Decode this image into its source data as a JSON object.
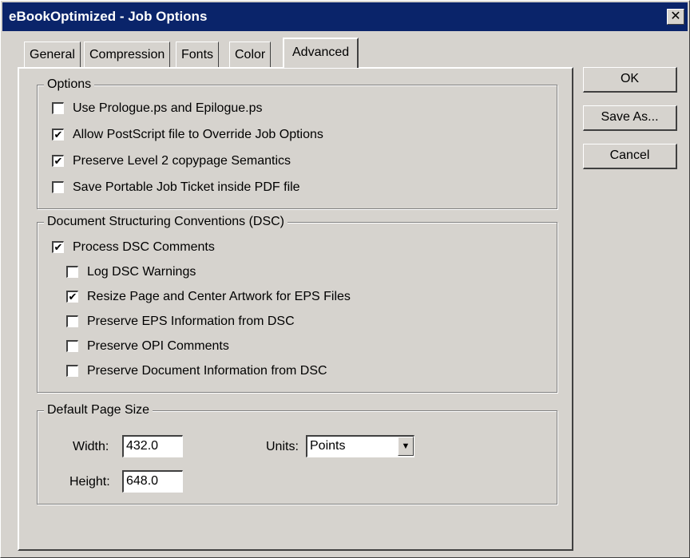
{
  "window": {
    "title": "eBookOptimized - Job Options",
    "close_glyph": "✕"
  },
  "tabs": [
    {
      "label": "General",
      "active": false
    },
    {
      "label": "Compression",
      "active": false
    },
    {
      "label": "Fonts",
      "active": false
    },
    {
      "label": "Color",
      "active": false
    },
    {
      "label": "Advanced",
      "active": true
    }
  ],
  "buttons": {
    "ok": "OK",
    "save_as": "Save As...",
    "cancel": "Cancel"
  },
  "options": {
    "title": "Options",
    "items": [
      {
        "label": "Use Prologue.ps and Epilogue.ps",
        "checked": false
      },
      {
        "label": "Allow PostScript file to Override Job Options",
        "checked": true
      },
      {
        "label": "Preserve Level 2 copypage Semantics",
        "checked": true
      },
      {
        "label": "Save Portable Job Ticket inside PDF file",
        "checked": false
      }
    ]
  },
  "dsc": {
    "title": "Document Structuring Conventions (DSC)",
    "process": {
      "label": "Process DSC Comments",
      "checked": true
    },
    "items": [
      {
        "label": "Log DSC Warnings",
        "checked": false
      },
      {
        "label": "Resize Page and Center Artwork for EPS Files",
        "checked": true
      },
      {
        "label": "Preserve EPS Information from DSC",
        "checked": false
      },
      {
        "label": "Preserve OPI Comments",
        "checked": false
      },
      {
        "label": "Preserve Document Information from DSC",
        "checked": false
      }
    ]
  },
  "page_size": {
    "title": "Default Page Size",
    "width_label": "Width:",
    "width_value": "432.0",
    "height_label": "Height:",
    "height_value": "648.0",
    "units_label": "Units:",
    "units_value": "Points"
  },
  "colors": {
    "titlebar": "#0a246a",
    "face": "#d6d3ce"
  }
}
